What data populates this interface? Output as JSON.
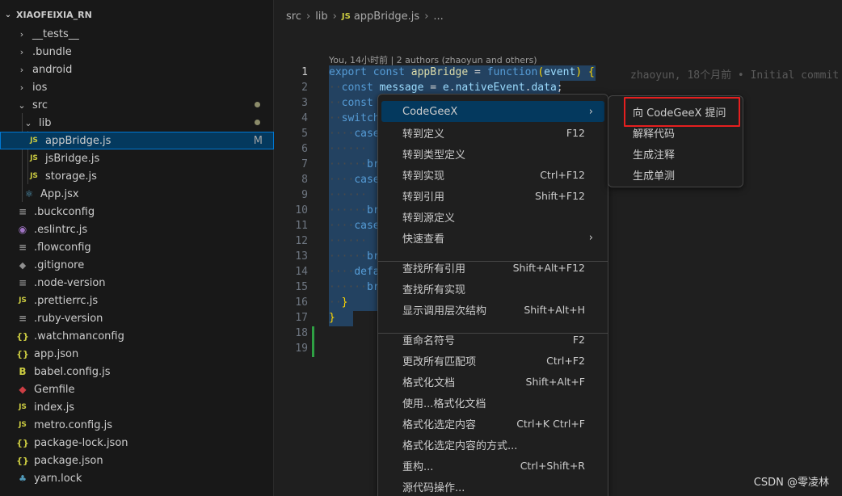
{
  "explorer": {
    "project": "XIAOFEIXIA_RN",
    "items": [
      {
        "label": "__tests__",
        "type": "folder",
        "depth": 1,
        "expanded": false
      },
      {
        "label": ".bundle",
        "type": "folder",
        "depth": 1,
        "expanded": false
      },
      {
        "label": "android",
        "type": "folder",
        "depth": 1,
        "expanded": false
      },
      {
        "label": "ios",
        "type": "folder",
        "depth": 1,
        "expanded": false
      },
      {
        "label": "src",
        "type": "folder",
        "depth": 1,
        "expanded": true,
        "dot": true
      },
      {
        "label": "lib",
        "type": "folder",
        "depth": 2,
        "expanded": true,
        "dot": true
      },
      {
        "label": "appBridge.js",
        "type": "js",
        "depth": 3,
        "selected": true,
        "badge": "M"
      },
      {
        "label": "jsBridge.js",
        "type": "js",
        "depth": 3
      },
      {
        "label": "storage.js",
        "type": "js",
        "depth": 3
      },
      {
        "label": "App.jsx",
        "type": "react",
        "depth": 2
      },
      {
        "label": ".buckconfig",
        "type": "lines",
        "depth": 1
      },
      {
        "label": ".eslintrc.js",
        "type": "eslint",
        "depth": 1
      },
      {
        "label": ".flowconfig",
        "type": "lines",
        "depth": 1
      },
      {
        "label": ".gitignore",
        "type": "git",
        "depth": 1
      },
      {
        "label": ".node-version",
        "type": "lines",
        "depth": 1
      },
      {
        "label": ".prettierrc.js",
        "type": "js",
        "depth": 1
      },
      {
        "label": ".ruby-version",
        "type": "lines",
        "depth": 1
      },
      {
        "label": ".watchmanconfig",
        "type": "json",
        "depth": 1
      },
      {
        "label": "app.json",
        "type": "json",
        "depth": 1
      },
      {
        "label": "babel.config.js",
        "type": "babel",
        "depth": 1
      },
      {
        "label": "Gemfile",
        "type": "gem",
        "depth": 1
      },
      {
        "label": "index.js",
        "type": "js",
        "depth": 1
      },
      {
        "label": "metro.config.js",
        "type": "js",
        "depth": 1
      },
      {
        "label": "package-lock.json",
        "type": "json",
        "depth": 1
      },
      {
        "label": "package.json",
        "type": "json",
        "depth": 1
      },
      {
        "label": "yarn.lock",
        "type": "yarn",
        "depth": 1
      }
    ],
    "icons": {
      "js": "JS",
      "json": "{}",
      "lines": "≡",
      "react": "⚛",
      "eslint": "◉",
      "git": "◆",
      "babel": "B",
      "gem": "◆",
      "yarn": "♣"
    }
  },
  "breadcrumb": {
    "parts": [
      "src",
      "lib"
    ],
    "file_icon": "JS",
    "file": "appBridge.js",
    "tail": "..."
  },
  "editor": {
    "blame_header": "You, 14小时前 | 2 authors (zhaoyun and others)",
    "inline_blame": "zhaoyun, 18个月前 • Initial commit",
    "line_numbers": [
      "1",
      "2",
      "3",
      "4",
      "5",
      "6",
      "7",
      "8",
      "9",
      "10",
      "11",
      "12",
      "13",
      "14",
      "15",
      "16",
      "17",
      "18",
      "19"
    ],
    "code": {
      "l1": {
        "k1": "export",
        "k2": "const",
        "v1": "appBridge",
        "op": " = ",
        "k3": "function",
        "p1": "(",
        "v2": "event",
        "p2": ")",
        "p3": "{"
      },
      "l2": {
        "k1": "const",
        "v1": "message",
        "op": " = ",
        "v2": "e",
        "dot1": ".",
        "v3": "nativeEvent",
        "dot2": ".",
        "v4": "data",
        "end": ";"
      },
      "l3": "const",
      "l4": "switch",
      "l5": "case",
      "l7": "br",
      "l8": "case",
      "l10": "br",
      "l11": "case",
      "l13": "br",
      "l14": "defa",
      "l15": "br",
      "l16": "}",
      "l17": "}"
    }
  },
  "context_menu": {
    "items": [
      {
        "label": "CodeGeeX",
        "key": "",
        "submenu": true
      },
      {
        "label": "转到定义",
        "key": "F12"
      },
      {
        "label": "转到类型定义",
        "key": ""
      },
      {
        "label": "转到实现",
        "key": "Ctrl+F12"
      },
      {
        "label": "转到引用",
        "key": "Shift+F12"
      },
      {
        "label": "转到源定义",
        "key": ""
      },
      {
        "label": "快速查看",
        "key": "",
        "submenu": true
      },
      {
        "label": "查找所有引用",
        "key": "Shift+Alt+F12"
      },
      {
        "label": "查找所有实现",
        "key": ""
      },
      {
        "label": "显示调用层次结构",
        "key": "Shift+Alt+H"
      },
      {
        "label": "重命名符号",
        "key": "F2"
      },
      {
        "label": "更改所有匹配项",
        "key": "Ctrl+F2"
      },
      {
        "label": "格式化文档",
        "key": "Shift+Alt+F"
      },
      {
        "label": "使用...格式化文档",
        "key": ""
      },
      {
        "label": "格式化选定内容",
        "key": "Ctrl+K Ctrl+F"
      },
      {
        "label": "格式化选定内容的方式...",
        "key": ""
      },
      {
        "label": "重构...",
        "key": "Ctrl+Shift+R"
      },
      {
        "label": "源代码操作...",
        "key": ""
      }
    ],
    "submenu_arrow": "›"
  },
  "codegeex_submenu": {
    "items": [
      "向 CodeGeeX 提问",
      "解释代码",
      "生成注释",
      "生成单测"
    ]
  },
  "watermark": "CSDN @零凌林"
}
